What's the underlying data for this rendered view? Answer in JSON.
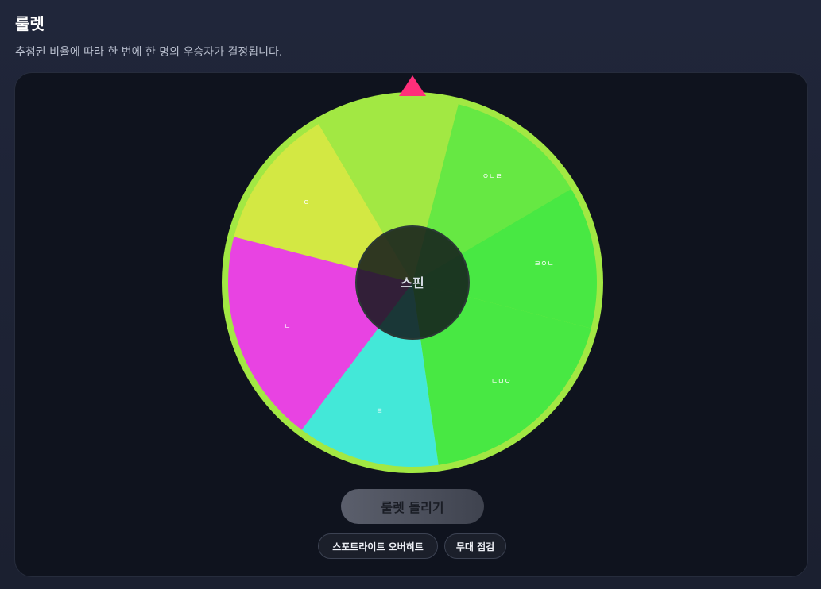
{
  "header": {
    "title": "룰렛",
    "subtitle": "추첨권 비율에 따라 한 번에 한 명의 우승자가 결정됩니다."
  },
  "wheel": {
    "center_label": "스핀",
    "pointer_color": "#ff2f7a",
    "segments": [
      {
        "label": "ㅇㄴㄹ",
        "color": "#66e843",
        "weight": 1
      },
      {
        "label": "ㄹㅇㄴ",
        "color": "#48e843",
        "weight": 1
      },
      {
        "label": "ㄴㅁㅇ",
        "color": "#48e843",
        "weight": 1.5
      },
      {
        "label": "ㄹ",
        "color": "#43e8d8",
        "weight": 1
      },
      {
        "label": "ㄴ",
        "color": "#e843e2",
        "weight": 1.5
      },
      {
        "label": "ㅇ",
        "color": "#d3e843",
        "weight": 1
      },
      {
        "label": "",
        "color": "#a2e843",
        "weight": 1
      }
    ]
  },
  "controls": {
    "spin_button_label": "룰렛 돌리기",
    "presets": [
      "스포트라이트 오버히트",
      "무대 점검"
    ]
  }
}
